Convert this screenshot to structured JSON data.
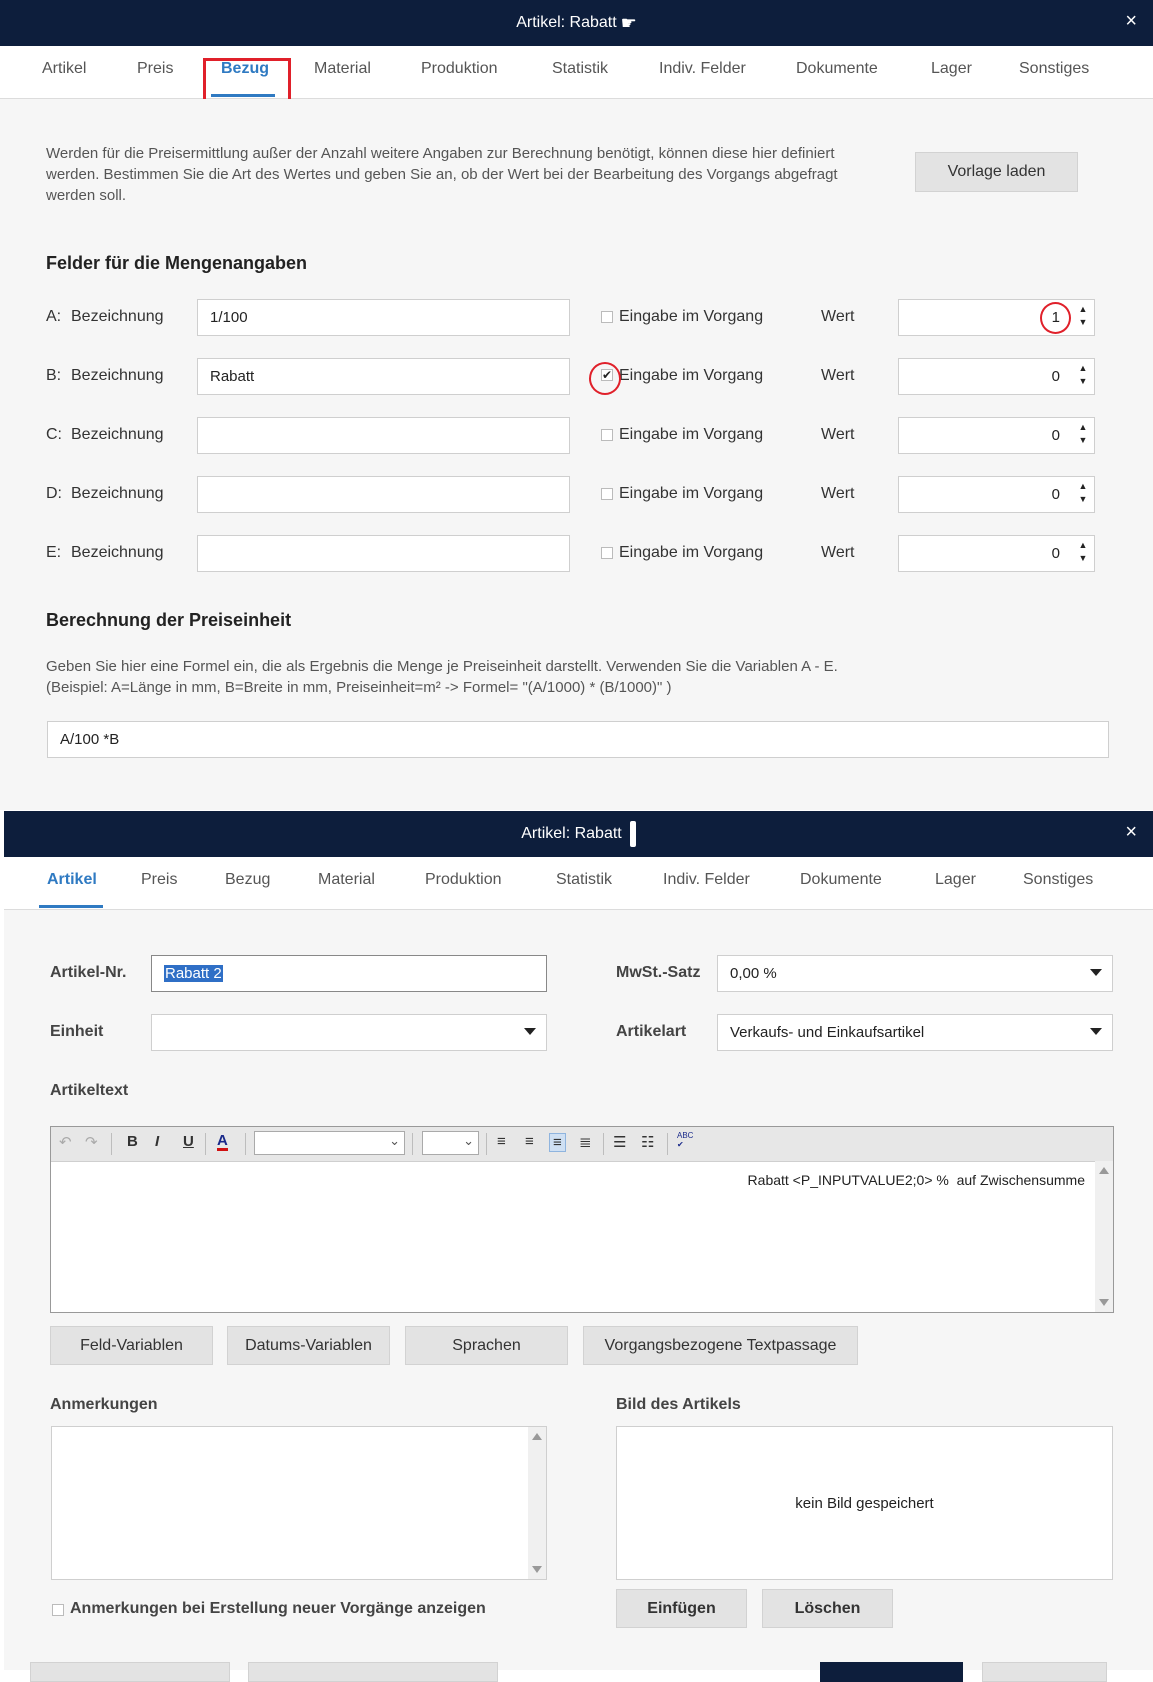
{
  "window1": {
    "title": "Artikel: Rabatt",
    "close": "×",
    "tabs": [
      "Artikel",
      "Preis",
      "Bezug",
      "Material",
      "Produktion",
      "Statistik",
      "Indiv. Felder",
      "Dokumente",
      "Lager",
      "Sonstiges"
    ],
    "active_tab": "Bezug",
    "intro": "Werden für die Preisermittlung außer der Anzahl weitere Angaben zur Berechnung benötigt, können diese hier definiert werden. Bestimmen Sie die Art des Wertes und geben Sie an, ob der Wert bei der Bearbeitung des Vorgangs abgefragt werden soll.",
    "template_button": "Vorlage laden",
    "fields_heading": "Felder für die Mengenangaben",
    "rows": [
      {
        "key": "A:",
        "label": "Bezeichnung",
        "name": "1/100",
        "checkbox_label": "Eingabe im Vorgang",
        "checked": false,
        "value_label": "Wert",
        "value": "1"
      },
      {
        "key": "B:",
        "label": "Bezeichnung",
        "name": "Rabatt",
        "checkbox_label": "Eingabe im Vorgang",
        "checked": true,
        "value_label": "Wert",
        "value": "0"
      },
      {
        "key": "C:",
        "label": "Bezeichnung",
        "name": "",
        "checkbox_label": "Eingabe im Vorgang",
        "checked": false,
        "value_label": "Wert",
        "value": "0"
      },
      {
        "key": "D:",
        "label": "Bezeichnung",
        "name": "",
        "checkbox_label": "Eingabe im Vorgang",
        "checked": false,
        "value_label": "Wert",
        "value": "0"
      },
      {
        "key": "E:",
        "label": "Bezeichnung",
        "name": "",
        "checkbox_label": "Eingabe im Vorgang",
        "checked": false,
        "value_label": "Wert",
        "value": "0"
      }
    ],
    "calc_heading": "Berechnung der Preiseinheit",
    "calc_text": "Geben Sie hier eine Formel ein, die als Ergebnis die Menge je Preiseinheit darstellt. Verwenden Sie die Variablen A - E. (Beispiel: A=Länge in mm, B=Breite in mm, Preiseinheit=m² -> Formel= \"(A/1000) * (B/1000)\" )",
    "formula": "A/100 *B"
  },
  "window2": {
    "title": "Artikel: Rabatt",
    "close": "×",
    "tabs": [
      "Artikel",
      "Preis",
      "Bezug",
      "Material",
      "Produktion",
      "Statistik",
      "Indiv. Felder",
      "Dokumente",
      "Lager",
      "Sonstiges"
    ],
    "active_tab": "Artikel",
    "article_no_label": "Artikel-Nr.",
    "article_no": "Rabatt 2",
    "vat_label": "MwSt.-Satz",
    "vat": "0,00 %",
    "unit_label": "Einheit",
    "unit": "",
    "type_label": "Artikelart",
    "type": "Verkaufs- und Einkaufsartikel",
    "text_label": "Artikeltext",
    "editor_text": "Rabatt <P_INPUTVALUE2;0> %  auf Zwischensumme",
    "toolbar": {
      "bold": "B",
      "italic": "I",
      "underline": "U",
      "font_color": "A",
      "spell": "ABC"
    },
    "buttons": [
      "Feld-Variablen",
      "Datums-Variablen",
      "Sprachen",
      "Vorgangsbezogene Textpassage"
    ],
    "notes_label": "Anmerkungen",
    "image_label": "Bild des Artikels",
    "no_image": "kein Bild gespeichert",
    "notes_checkbox": "Anmerkungen bei Erstellung neuer Vorgänge anzeigen",
    "insert_button": "Einfügen",
    "delete_button": "Löschen"
  },
  "colors": {
    "titlebar": "#0d1e3c",
    "accent": "#2f7ac2",
    "highlight": "#e0202a"
  }
}
